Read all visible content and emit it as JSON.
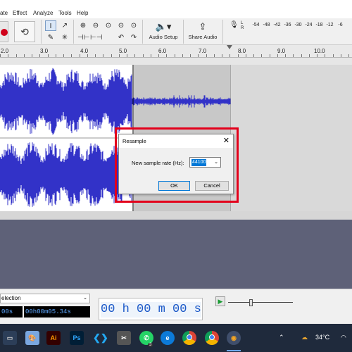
{
  "menu": {
    "items": [
      "ate",
      "Effect",
      "Analyze",
      "Tools",
      "Help"
    ]
  },
  "toolbar": {
    "audio_setup_label": "Audio Setup",
    "share_audio_label": "Share Audio",
    "meter_channels": "L\nR",
    "meter_ticks": [
      "-54",
      "-48",
      "-42",
      "-36",
      "-30",
      "-24",
      "-18",
      "-12",
      "-6"
    ]
  },
  "ruler": {
    "labels": [
      "2.0",
      "3.0",
      "4.0",
      "5.0",
      "6.0",
      "7.0",
      "8.0",
      "9.0",
      "10.0"
    ]
  },
  "dialog": {
    "title": "Resample",
    "sample_rate_label": "New sample rate (Hz):",
    "sample_rate_value": "44100",
    "ok_label": "OK",
    "cancel_label": "Cancel",
    "close_glyph": "✕"
  },
  "selection_toolbar": {
    "mode_label": "election",
    "start_time": "00h00m05.34s",
    "start_time_prefix": "00s",
    "time_display": "00 h 00 m 00 s"
  },
  "taskbar": {
    "weather": "34°C",
    "whatsapp_badge": "3",
    "icons": [
      "paint-icon",
      "illustrator-icon",
      "photoshop-icon",
      "vscode-icon",
      "snipping-tool-icon",
      "whatsapp-icon",
      "edge-icon",
      "chrome-icon",
      "chrome-profile-icon",
      "audacity-icon"
    ]
  },
  "colors": {
    "waveform": "#3232c8",
    "selection_bg": "#ffffff",
    "highlight_box": "#e3001b",
    "taskbar": "#1f2a3c",
    "track_panel_bg": "#5e6178"
  }
}
